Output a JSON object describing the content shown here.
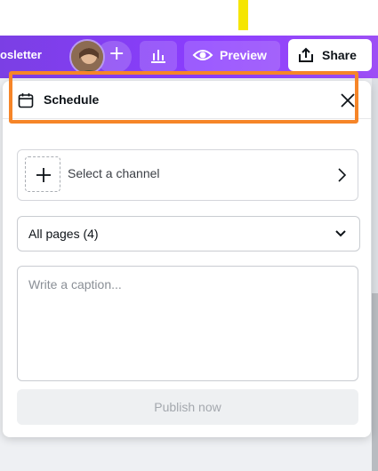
{
  "header": {
    "title_fragment": "osletter",
    "preview_label": "Preview",
    "share_label": "Share",
    "add_label": "+"
  },
  "schedule": {
    "title": "Schedule",
    "channel_label": "Select a channel",
    "pages_selected": "All pages (4)",
    "caption_placeholder": "Write a caption...",
    "publish_label": "Publish now"
  },
  "colors": {
    "brand_purple": "#8b3dff",
    "highlight": "#f68528",
    "marker_yellow": "#f5e500"
  },
  "icons": [
    "calendar-icon",
    "close-icon",
    "plus-icon",
    "chevron-right-icon",
    "chevron-down-icon",
    "eye-icon",
    "chart-icon",
    "upload-icon"
  ]
}
